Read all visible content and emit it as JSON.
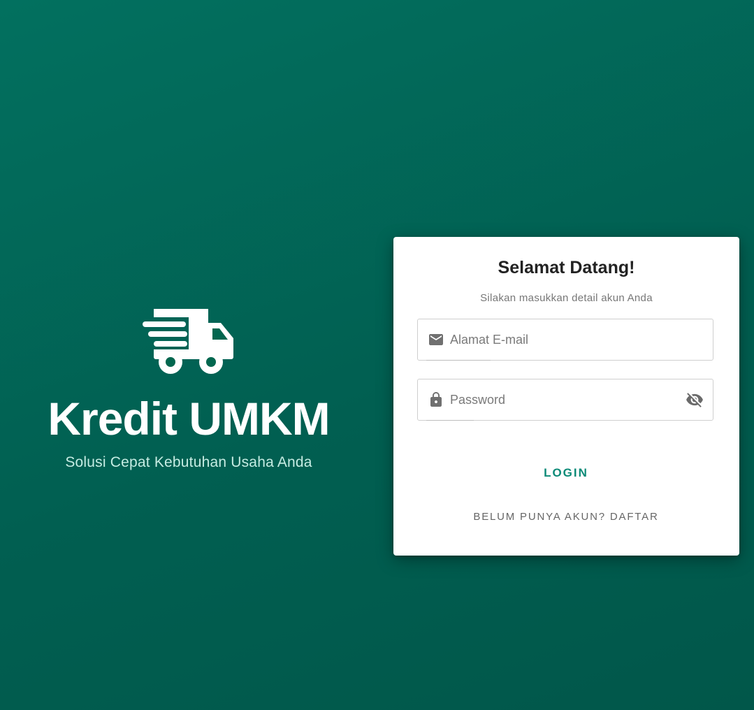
{
  "brand": {
    "icon": "truck-fast-icon",
    "title": "Kredit UMKM",
    "tagline": "Solusi Cepat Kebutuhan Usaha Anda"
  },
  "login_card": {
    "title": "Selamat Datang!",
    "subtitle": "Silakan masukkan detail akun Anda",
    "email_field": {
      "icon": "email-icon",
      "placeholder": "Alamat E-mail",
      "value": ""
    },
    "password_field": {
      "icon": "lock-icon",
      "placeholder": "Password",
      "value": "",
      "toggle_icon": "visibility-off-icon"
    },
    "login_button": "LOGIN",
    "register_button": "BELUM PUNYA AKUN? DAFTAR"
  },
  "colors": {
    "background_start": "#02705f",
    "background_end": "#01574a",
    "accent": "#0b8a77",
    "card": "#ffffff"
  }
}
